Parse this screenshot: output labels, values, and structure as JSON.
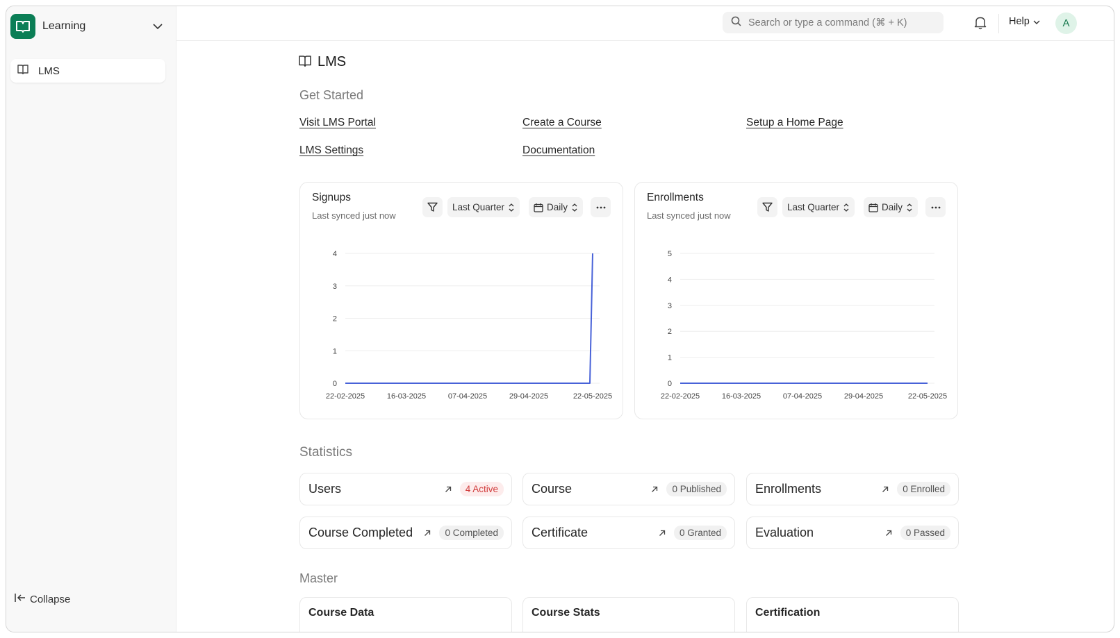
{
  "app": {
    "name": "Learning",
    "brand_color": "#0b7e56"
  },
  "sidebar": {
    "items": [
      {
        "label": "LMS",
        "icon": "book-icon",
        "active": true
      }
    ],
    "collapse_label": "Collapse"
  },
  "topbar": {
    "search_placeholder": "Search or type a command (⌘ + K)",
    "help_label": "Help",
    "avatar_initial": "A"
  },
  "workspace": {
    "title": "LMS"
  },
  "get_started": {
    "heading": "Get Started",
    "links": [
      "Visit LMS Portal",
      "Create a Course",
      "Setup a Home Page",
      "LMS Settings",
      "Documentation"
    ]
  },
  "charts": [
    {
      "title": "Signups",
      "subtitle": "Last synced just now",
      "range": "Last Quarter",
      "interval": "Daily",
      "chart_data": {
        "type": "line",
        "line_color": "#4862d8",
        "x_tick_labels": [
          "22-02-2025",
          "16-03-2025",
          "07-04-2025",
          "29-04-2025",
          "22-05-2025"
        ],
        "ylim": [
          0,
          4
        ],
        "y_ticks": [
          0,
          1,
          2,
          3,
          4
        ],
        "points": [
          {
            "x": "22-02-2025",
            "y": 0
          },
          {
            "x": "21-05-2025",
            "y": 0
          },
          {
            "x": "22-05-2025",
            "y": 4
          }
        ]
      }
    },
    {
      "title": "Enrollments",
      "subtitle": "Last synced just now",
      "range": "Last Quarter",
      "interval": "Daily",
      "chart_data": {
        "type": "line",
        "line_color": "#4862d8",
        "x_tick_labels": [
          "22-02-2025",
          "16-03-2025",
          "07-04-2025",
          "29-04-2025",
          "22-05-2025"
        ],
        "ylim": [
          0,
          5
        ],
        "y_ticks": [
          0,
          1,
          2,
          3,
          4,
          5
        ],
        "points": [
          {
            "x": "22-02-2025",
            "y": 0
          },
          {
            "x": "22-05-2025",
            "y": 0
          }
        ]
      }
    }
  ],
  "statistics": {
    "heading": "Statistics",
    "cards": [
      {
        "name": "Users",
        "badge": "4 Active",
        "badge_style": "red"
      },
      {
        "name": "Course",
        "badge": "0 Published",
        "badge_style": "gray"
      },
      {
        "name": "Enrollments",
        "badge": "0 Enrolled",
        "badge_style": "gray"
      },
      {
        "name": "Course Completed",
        "badge": "0 Completed",
        "badge_style": "gray"
      },
      {
        "name": "Certificate",
        "badge": "0 Granted",
        "badge_style": "gray"
      },
      {
        "name": "Evaluation",
        "badge": "0 Passed",
        "badge_style": "gray"
      }
    ]
  },
  "master": {
    "heading": "Master",
    "cards": [
      {
        "name": "Course Data"
      },
      {
        "name": "Course Stats"
      },
      {
        "name": "Certification"
      }
    ]
  }
}
